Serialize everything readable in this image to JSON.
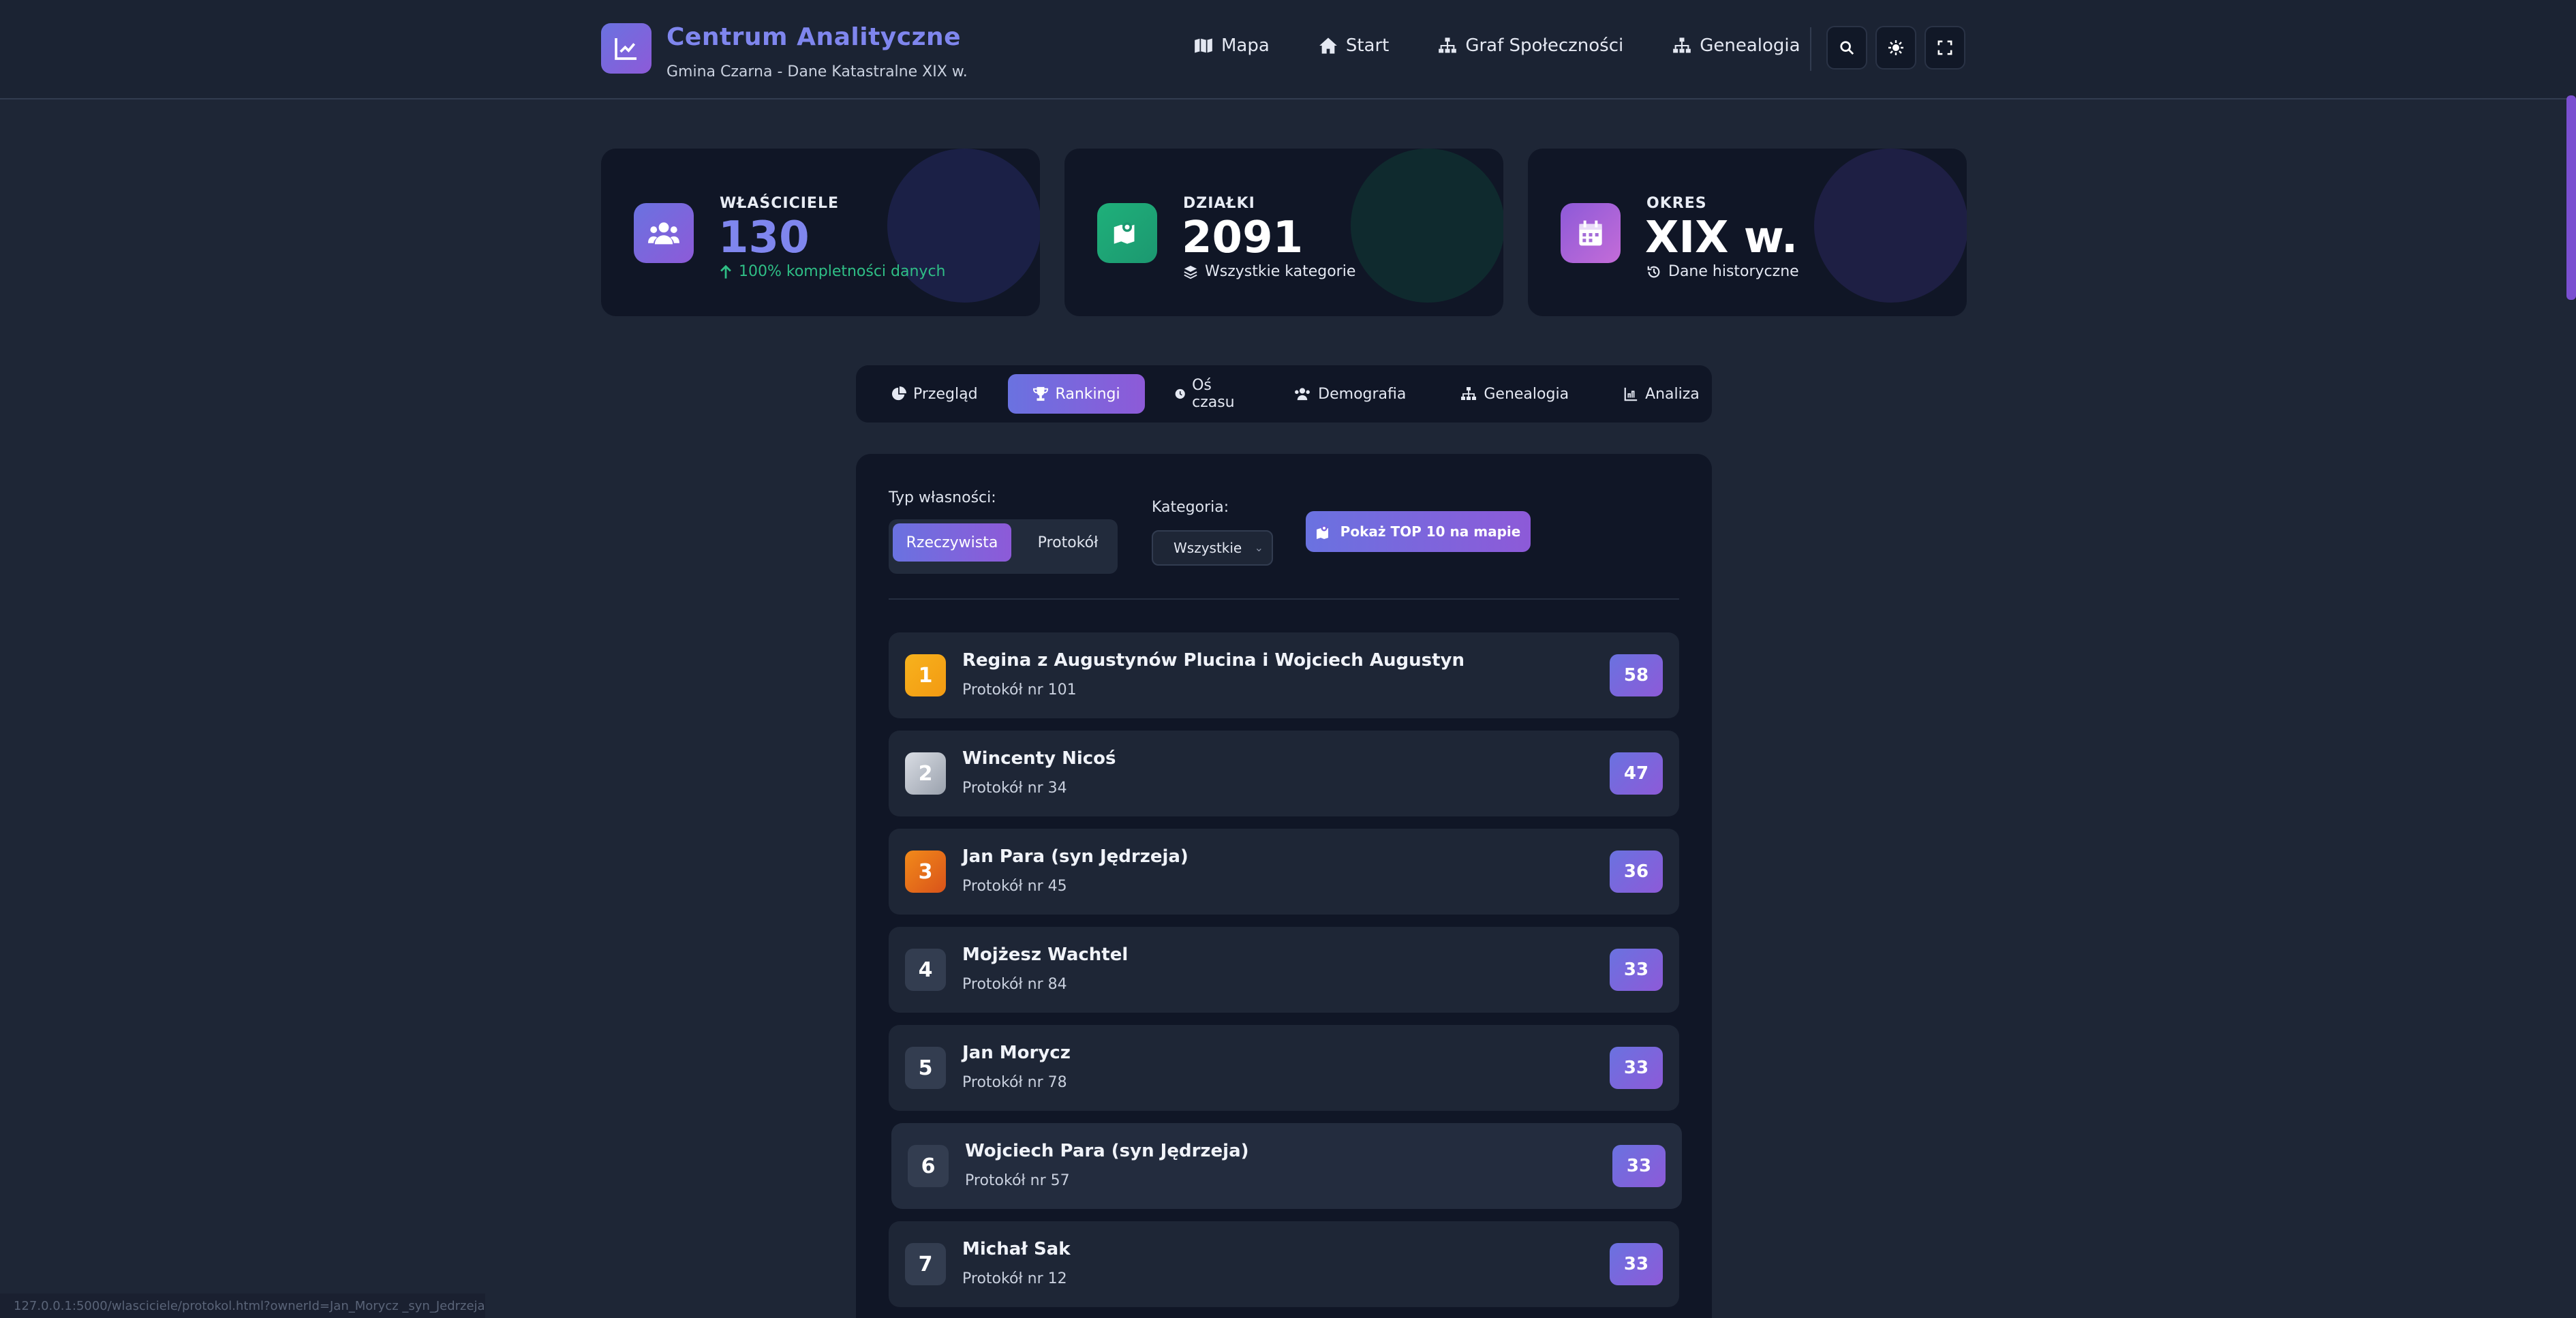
{
  "app": {
    "title": "Centrum Analityczne",
    "subtitle": "Gmina Czarna - Dane Katastralne XIX w."
  },
  "nav": [
    {
      "label": "Mapa",
      "icon": "map-icon"
    },
    {
      "label": "Start",
      "icon": "home-icon"
    },
    {
      "label": "Graf Społeczności",
      "icon": "sitemap-icon"
    },
    {
      "label": "Genealogia",
      "icon": "sitemap-icon"
    }
  ],
  "header_buttons": [
    "search-icon",
    "theme-icon",
    "fullscreen-icon"
  ],
  "stats": [
    {
      "label": "WŁAŚCICIELE",
      "value": "130",
      "foot": "100% kompletności danych",
      "foot_icon": "arrow-up-icon",
      "color": "#7f86ee",
      "foot_color": "#2fbf86"
    },
    {
      "label": "DZIAŁKI",
      "value": "2091",
      "foot": "Wszystkie kategorie",
      "foot_icon": "layers-icon",
      "color": "#ffffff",
      "foot_color": "#e4e8f2"
    },
    {
      "label": "OKRES",
      "value": "XIX w.",
      "foot": "Dane historyczne",
      "foot_icon": "history-icon",
      "color": "#ffffff",
      "foot_color": "#e4e8f2"
    }
  ],
  "tabs": [
    {
      "label": "Przegląd",
      "icon": "pie-chart-icon"
    },
    {
      "label": "Rankingi",
      "icon": "trophy-icon",
      "active": true
    },
    {
      "label": "Oś czasu",
      "icon": "clock-icon"
    },
    {
      "label": "Demografia",
      "icon": "users-icon"
    },
    {
      "label": "Genealogia",
      "icon": "sitemap-icon"
    },
    {
      "label": "Analiza",
      "icon": "chart-icon"
    }
  ],
  "filters": {
    "ownership_label": "Typ własności:",
    "ownership_options": [
      "Rzeczywista",
      "Protokół"
    ],
    "ownership_selected": "Rzeczywista",
    "category_label": "Kategoria:",
    "category_value": "Wszystkie",
    "map_button": "Pokaż TOP 10 na mapie"
  },
  "ranking": [
    {
      "rank": "1",
      "name": "Regina z Augustynów Plucina i Wojciech Augustyn",
      "sub": "Protokół nr 101",
      "score": "58"
    },
    {
      "rank": "2",
      "name": "Wincenty Nicoś",
      "sub": "Protokół nr 34",
      "score": "47"
    },
    {
      "rank": "3",
      "name": "Jan Para (syn Jędrzeja)",
      "sub": "Protokół nr 45",
      "score": "36"
    },
    {
      "rank": "4",
      "name": "Mojżesz Wachtel",
      "sub": "Protokół nr 84",
      "score": "33"
    },
    {
      "rank": "5",
      "name": "Jan Morycz",
      "sub": "Protokół nr 78",
      "score": "33"
    },
    {
      "rank": "6",
      "name": "Wojciech Para (syn Jędrzeja)",
      "sub": "Protokół nr 57",
      "score": "33"
    },
    {
      "rank": "7",
      "name": "Michał Sak",
      "sub": "Protokół nr 12",
      "score": "33"
    }
  ],
  "status_url": "127.0.0.1:5000/wlasciciele/protokol.html?ownerId=Jan_Morycz  _syn_Jedrzeja"
}
